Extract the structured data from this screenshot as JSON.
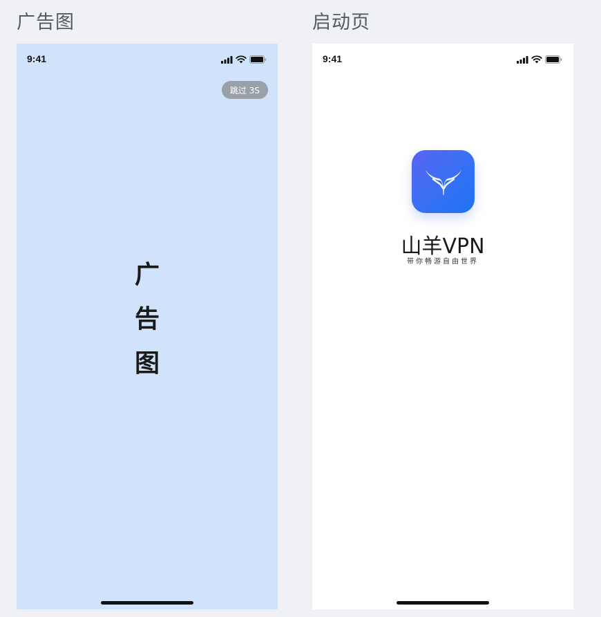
{
  "sections": {
    "ad_title": "广告图",
    "splash_title": "启动页"
  },
  "ad_screen": {
    "status_time": "9:41",
    "skip_label": "跳过 3S",
    "vertical_text": [
      "广",
      "告",
      "图"
    ],
    "background": "#d1e3fa"
  },
  "splash_screen": {
    "status_time": "9:41",
    "app_name": "山羊VPN",
    "slogan": "带你畅游自由世界",
    "logo_icon": "goat-horns-icon",
    "logo_gradient": [
      "#5a63f2",
      "#1b74f0"
    ],
    "background": "#ffffff"
  },
  "status_icons": [
    "signal-icon",
    "wifi-icon",
    "battery-icon"
  ]
}
